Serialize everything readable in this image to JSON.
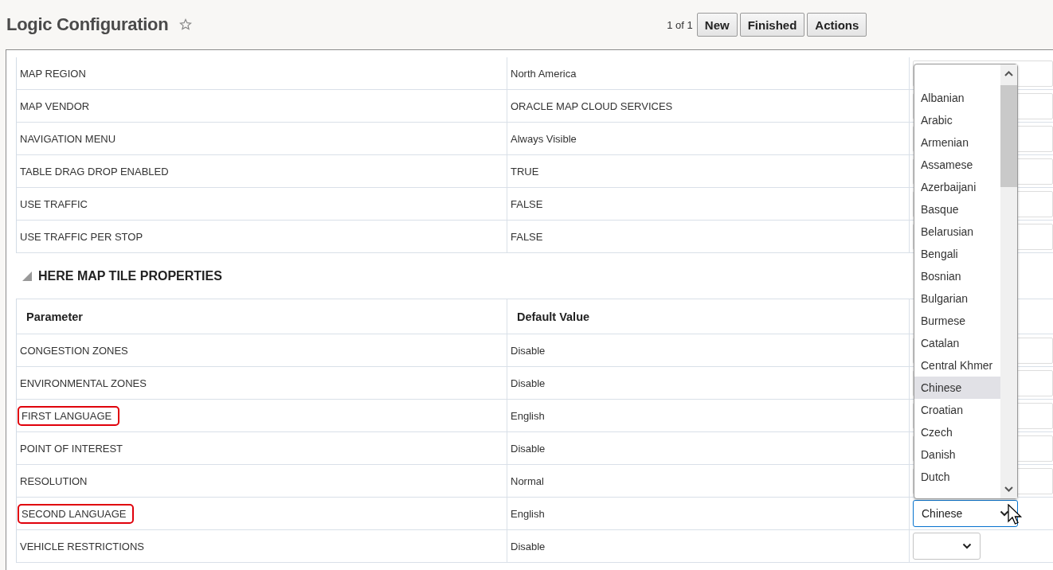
{
  "header": {
    "title": "Logic Configuration",
    "pager": "1 of 1",
    "buttons": [
      "New",
      "Finished",
      "Actions"
    ]
  },
  "top_table": {
    "rows": [
      {
        "parameter": "MAP REGION",
        "default_value": "North America"
      },
      {
        "parameter": "MAP VENDOR",
        "default_value": "ORACLE MAP CLOUD SERVICES"
      },
      {
        "parameter": "NAVIGATION MENU",
        "default_value": "Always Visible"
      },
      {
        "parameter": "TABLE DRAG DROP ENABLED",
        "default_value": "TRUE"
      },
      {
        "parameter": "USE TRAFFIC",
        "default_value": "FALSE"
      },
      {
        "parameter": "USE TRAFFIC PER STOP",
        "default_value": "FALSE"
      }
    ]
  },
  "section": {
    "title": "HERE MAP TILE PROPERTIES",
    "expanded": true
  },
  "here_table": {
    "columns": [
      "Parameter",
      "Default Value"
    ],
    "rows": [
      {
        "parameter": "CONGESTION ZONES",
        "default_value": "Disable",
        "highlighted": false
      },
      {
        "parameter": "ENVIRONMENTAL ZONES",
        "default_value": "Disable",
        "highlighted": false
      },
      {
        "parameter": "FIRST LANGUAGE",
        "default_value": "English",
        "highlighted": true
      },
      {
        "parameter": "POINT OF INTEREST",
        "default_value": "Disable",
        "highlighted": false
      },
      {
        "parameter": "RESOLUTION",
        "default_value": "Normal",
        "highlighted": false
      },
      {
        "parameter": "SECOND LANGUAGE",
        "default_value": "English",
        "highlighted": true,
        "dropdown": {
          "value": "Chinese",
          "focused": true
        }
      },
      {
        "parameter": "VEHICLE RESTRICTIONS",
        "default_value": "Disable",
        "highlighted": false,
        "dropdown": {
          "focused": false
        }
      }
    ]
  },
  "language_list": {
    "items": [
      {
        "label": "Albanian",
        "selected": false
      },
      {
        "label": "Arabic",
        "selected": false
      },
      {
        "label": "Armenian",
        "selected": false
      },
      {
        "label": "Assamese",
        "selected": false
      },
      {
        "label": "Azerbaijani",
        "selected": false
      },
      {
        "label": "Basque",
        "selected": false
      },
      {
        "label": "Belarusian",
        "selected": false
      },
      {
        "label": "Bengali",
        "selected": false
      },
      {
        "label": "Bosnian",
        "selected": false
      },
      {
        "label": "Bulgarian",
        "selected": false
      },
      {
        "label": "Burmese",
        "selected": false
      },
      {
        "label": "Catalan",
        "selected": false
      },
      {
        "label": "Central Khmer",
        "selected": false
      },
      {
        "label": "Chinese",
        "selected": true
      },
      {
        "label": "Croatian",
        "selected": false
      },
      {
        "label": "Czech",
        "selected": false
      },
      {
        "label": "Danish",
        "selected": false
      },
      {
        "label": "Dutch",
        "selected": false
      }
    ]
  }
}
